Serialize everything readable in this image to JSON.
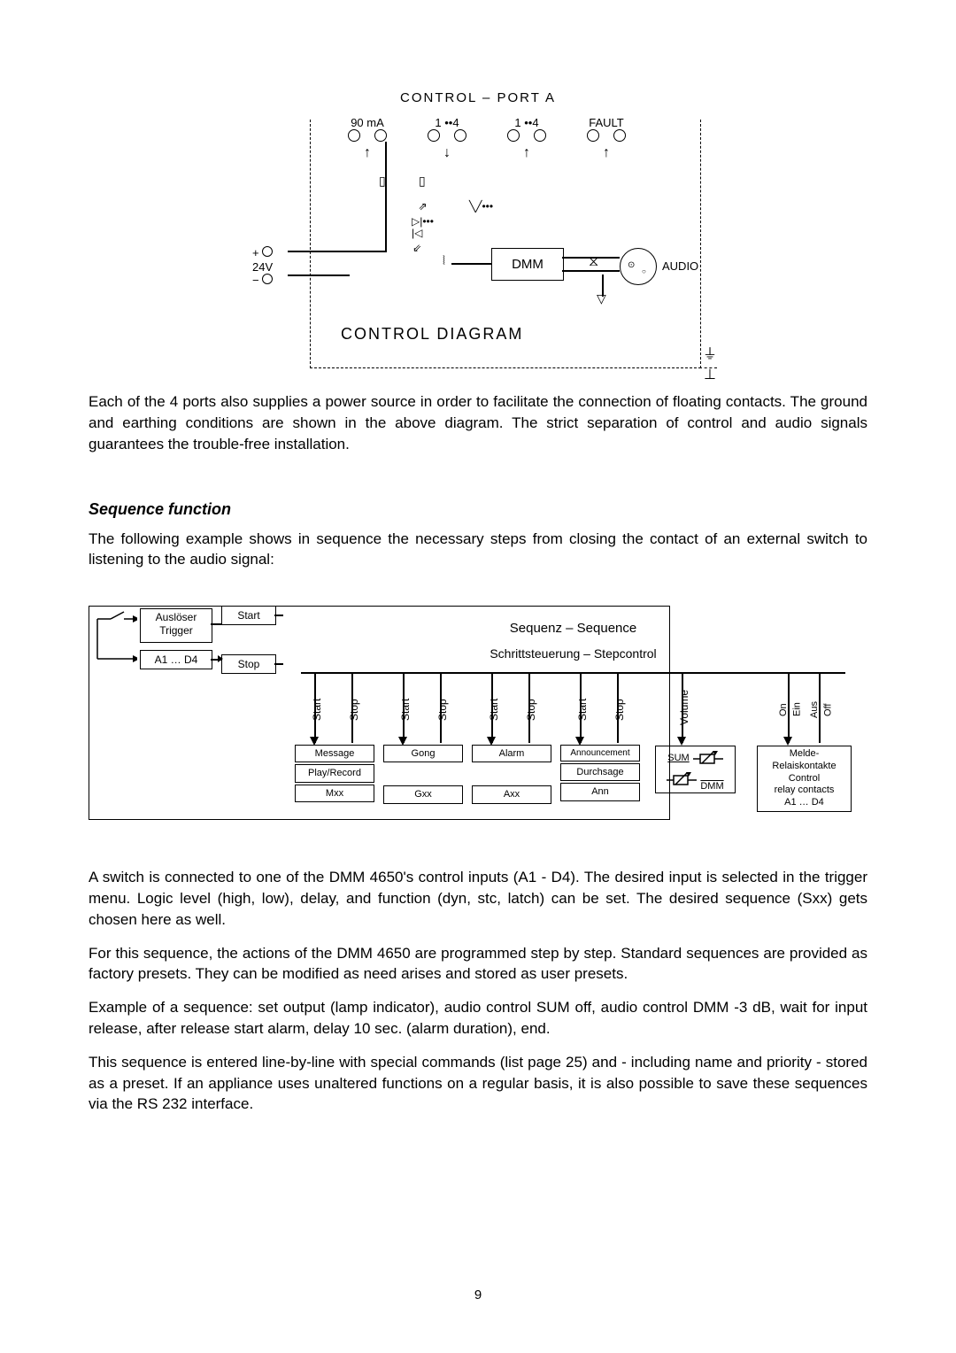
{
  "topDiagram": {
    "title": "CONTROL – PORT A",
    "terminals": [
      "90 mA",
      "1 ••4",
      "1 ••4",
      "FAULT"
    ],
    "v24_plus": "+",
    "v24_label": "24V",
    "v24_minus": "−",
    "dmm": "DMM",
    "audio": "AUDIO",
    "controlLabel": "CONTROL DIAGRAM"
  },
  "para1": "Each of the 4 ports also supplies a power source in order to facilitate the connection of floating contacts. The ground and earthing conditions are shown in the above diagram. The strict separation of control and audio signals guarantees the trouble-free installation.",
  "sectionHeading": "Sequence function",
  "para2": "The following example shows in sequence the necessary steps from closing the contact of an external switch to listening to the audio signal:",
  "seqDiagram": {
    "trigger1": "Auslöser",
    "trigger2": "Trigger",
    "a1d4": "A1 … D4",
    "startLabel": "Start",
    "stopLabel": "Stop",
    "seqTitle": "Sequenz – Sequence",
    "stepTitle": "Schrittsteuerung – Stepcontrol",
    "vertStart": "Start",
    "vertStop": "Stop",
    "vertVolume": "Volume",
    "onEin": "On\nEin",
    "ausOff": "Aus\nOff",
    "cols": [
      {
        "l1": "Message",
        "l2": "Play/Record",
        "l3": "Mxx"
      },
      {
        "l1": "Gong",
        "l2": "",
        "l3": "Gxx"
      },
      {
        "l1": "Alarm",
        "l2": "",
        "l3": "Axx"
      },
      {
        "l1": "Announcement",
        "l2": "Durchsage",
        "l3": "Ann"
      }
    ],
    "sumLabel": "SUM",
    "dmmLabel": "DMM",
    "relayBox1": "Melde-",
    "relayBox2": "Relaiskontakte",
    "relayBox3": "Control",
    "relayBox4": "relay contacts",
    "relayBox5": "A1 … D4"
  },
  "para3": "A switch is connected to one of the DMM 4650's control inputs (A1 - D4). The desired input is selected in the trigger menu. Logic level (high, low), delay, and function (dyn, stc, latch) can be set. The desired sequence (Sxx) gets chosen here as well.",
  "para4": "For this sequence, the actions of the DMM 4650 are programmed step by step. Standard sequences are provided as factory presets. They can be modified as need arises and stored as user presets.",
  "para5": "Example of a sequence: set output (lamp indicator), audio control SUM off, audio control DMM -3 dB, wait for input release, after release start alarm, delay 10 sec. (alarm duration), end.",
  "para6": "This sequence is entered line-by-line with special commands (list page 25) and - including name and priority - stored as a preset. If an appliance uses unaltered functions on a regular basis, it is also possible to save these sequences via the RS 232 interface.",
  "pageNumber": "9"
}
